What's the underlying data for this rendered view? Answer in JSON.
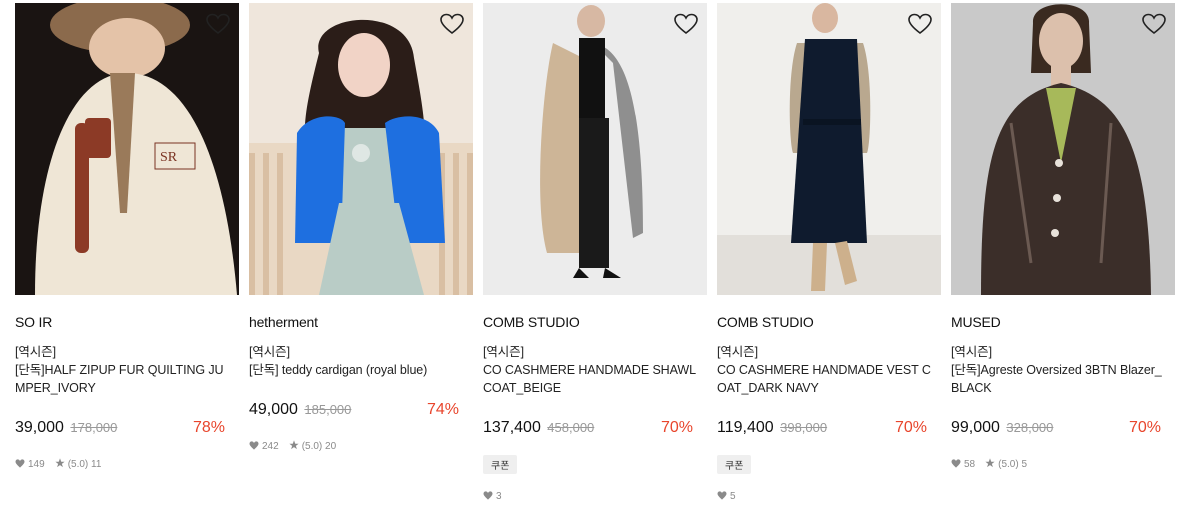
{
  "products": [
    {
      "brand": "SO IR",
      "title": "[역시즌]\n[단독]HALF ZIPUP FUR QUILTING JUMPER_IVORY",
      "price": "39,000",
      "original_price": "178,000",
      "discount": "78%",
      "coupon": "",
      "likes": "149",
      "rating": "(5.0) 11",
      "image_desc": "model in ivory fleece jumper with brown fur hat",
      "wish_icon": "heart-outline-icon"
    },
    {
      "brand": "hetherment",
      "title": "[역시즌]\n[단독] teddy cardigan (royal blue)",
      "price": "49,000",
      "original_price": "185,000",
      "discount": "74%",
      "coupon": "",
      "likes": "242",
      "rating": "(5.0) 20",
      "image_desc": "model in royal blue fuzzy cardigan",
      "wish_icon": "heart-outline-icon"
    },
    {
      "brand": "COMB STUDIO",
      "title": "[역시즌]\nCO CASHMERE HANDMADE SHAWL COAT_BEIGE",
      "price": "137,400",
      "original_price": "458,000",
      "discount": "70%",
      "coupon": "쿠폰",
      "likes": "3",
      "rating": "",
      "image_desc": "model in beige shawl coat",
      "wish_icon": "heart-outline-icon"
    },
    {
      "brand": "COMB STUDIO",
      "title": "[역시즌]\nCO CASHMERE HANDMADE VEST COAT_DARK NAVY",
      "price": "119,400",
      "original_price": "398,000",
      "discount": "70%",
      "coupon": "쿠폰",
      "likes": "5",
      "rating": "",
      "image_desc": "model in dark navy vest coat",
      "wish_icon": "heart-outline-icon"
    },
    {
      "brand": "MUSED",
      "title": "[역시즌]\n[단독]Agreste Oversized 3BTN Blazer_BLACK",
      "price": "99,000",
      "original_price": "328,000",
      "discount": "70%",
      "coupon": "",
      "likes": "58",
      "rating": "(5.0) 5",
      "image_desc": "model in black leather blazer",
      "wish_icon": "heart-outline-icon"
    }
  ],
  "colors": {
    "discount": "#e8452c",
    "muted": "#8a8a8a"
  }
}
